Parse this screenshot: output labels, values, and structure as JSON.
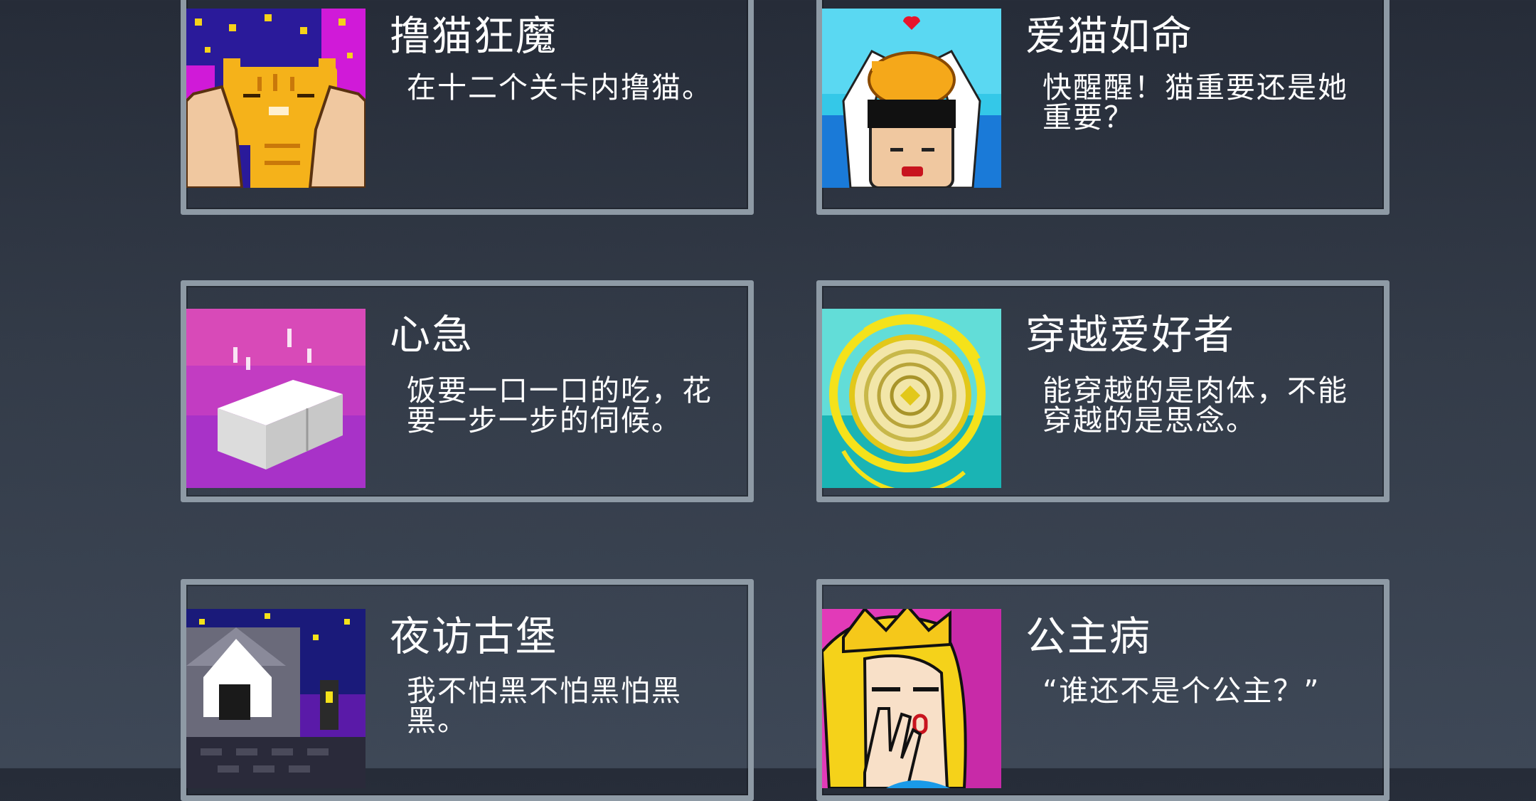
{
  "achievements": [
    {
      "title": "撸猫狂魔",
      "description": "在十二个关卡内撸猫。",
      "icon": "cat-petting-icon"
    },
    {
      "title": "爱猫如命",
      "description": "快醒醒！猫重要还是她重要？",
      "icon": "cat-on-head-icon"
    },
    {
      "title": "心急",
      "description": "饭要一口一口的吃，花要一步一步的伺候。",
      "icon": "steaming-tofu-icon"
    },
    {
      "title": "穿越爱好者",
      "description": "能穿越的是肉体，不能穿越的是思念。",
      "icon": "time-portal-icon"
    },
    {
      "title": "夜访古堡",
      "description": "我不怕黑不怕黑怕黑黑。",
      "icon": "night-castle-icon"
    },
    {
      "title": "公主病",
      "description": "“谁还不是个公主？”",
      "icon": "crying-princess-icon"
    }
  ],
  "colors": {
    "frame": "#8e9aa5",
    "background": "#2e3542",
    "text": "#ffffff"
  }
}
